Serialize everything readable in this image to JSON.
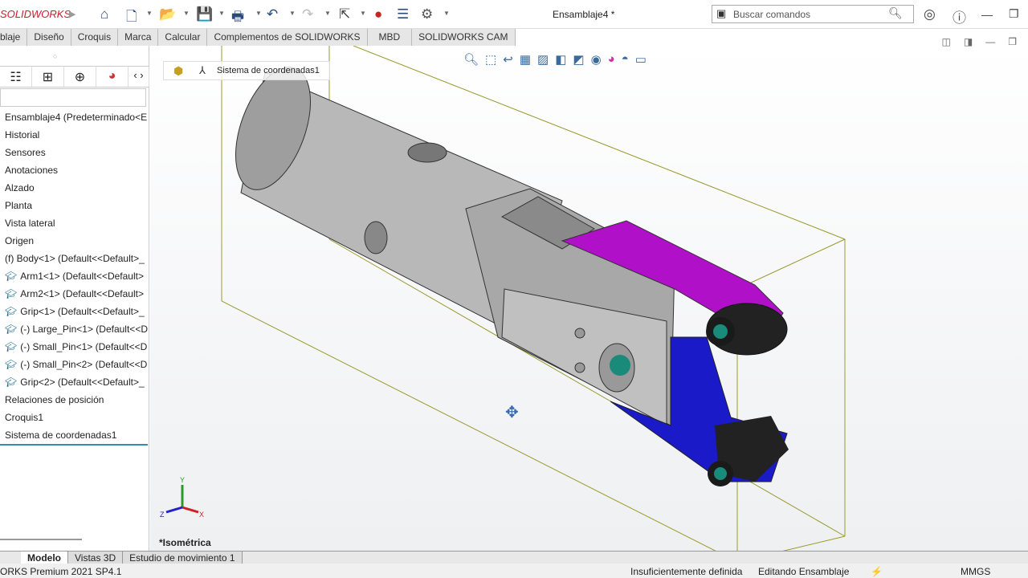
{
  "app": {
    "logo": "SOLIDWORKS",
    "document_title": "Ensamblaje4 *"
  },
  "search": {
    "placeholder": "Buscar comandos"
  },
  "ribbon_tabs": [
    "blaje",
    "Diseño",
    "Croquis",
    "Marca",
    "Calcular",
    "Complementos de SOLIDWORKS",
    "MBD",
    "SOLIDWORKS CAM"
  ],
  "breadcrumb": {
    "item": "Sistema de coordenadas1"
  },
  "tree": [
    {
      "label": "Ensamblaje4  (Predeterminado<E",
      "cap": false
    },
    {
      "label": "Historial",
      "cap": false
    },
    {
      "label": "Sensores",
      "cap": false
    },
    {
      "label": "Anotaciones",
      "cap": false
    },
    {
      "label": "Alzado",
      "cap": false
    },
    {
      "label": "Planta",
      "cap": false
    },
    {
      "label": "Vista lateral",
      "cap": false
    },
    {
      "label": "Origen",
      "cap": false
    },
    {
      "label": "(f) Body<1> (Default<<Default>_",
      "cap": false
    },
    {
      "label": "Arm1<1> (Default<<Default>",
      "cap": true
    },
    {
      "label": "Arm2<1> (Default<<Default>",
      "cap": true
    },
    {
      "label": "Grip<1> (Default<<Default>_",
      "cap": true
    },
    {
      "label": "(-) Large_Pin<1> (Default<<D",
      "cap": true
    },
    {
      "label": "(-) Small_Pin<1> (Default<<D",
      "cap": true
    },
    {
      "label": "(-) Small_Pin<2> (Default<<D",
      "cap": true
    },
    {
      "label": "Grip<2> (Default<<Default>_",
      "cap": true
    },
    {
      "label": "Relaciones de posición",
      "cap": false
    },
    {
      "label": "Croquis1",
      "cap": false
    },
    {
      "label": "Sistema de coordenadas1",
      "cap": false
    }
  ],
  "view": {
    "orientation": "*Isométrica",
    "axis_x": "X",
    "axis_y": "Y",
    "axis_z": "Z"
  },
  "bottom_tabs": [
    "Modelo",
    "Vistas 3D",
    "Estudio de movimiento 1"
  ],
  "status": {
    "version": "ORKS Premium 2021 SP4.1",
    "definition": "Insuficientemente definida",
    "mode": "Editando Ensamblaje",
    "units": "MMGS"
  }
}
